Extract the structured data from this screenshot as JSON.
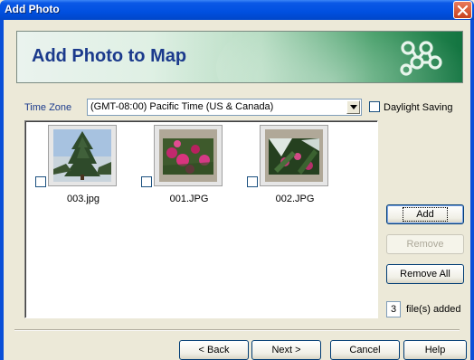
{
  "window": {
    "title": "Add Photo"
  },
  "banner": {
    "heading": "Add Photo to Map"
  },
  "timezone": {
    "label": "Time Zone",
    "selected": "(GMT-08:00) Pacific Time (US & Canada)",
    "daylight_label": "Daylight Saving",
    "daylight_checked": false
  },
  "photos": [
    {
      "name": "003.jpg",
      "checked": false
    },
    {
      "name": "001.JPG",
      "checked": false
    },
    {
      "name": "002.JPG",
      "checked": false
    }
  ],
  "side_buttons": {
    "add": "Add",
    "remove": "Remove",
    "remove_all": "Remove All"
  },
  "status": {
    "count": "3",
    "label": "file(s) added"
  },
  "footer": {
    "back": "< Back",
    "next": "Next >",
    "cancel": "Cancel",
    "help": "Help"
  }
}
